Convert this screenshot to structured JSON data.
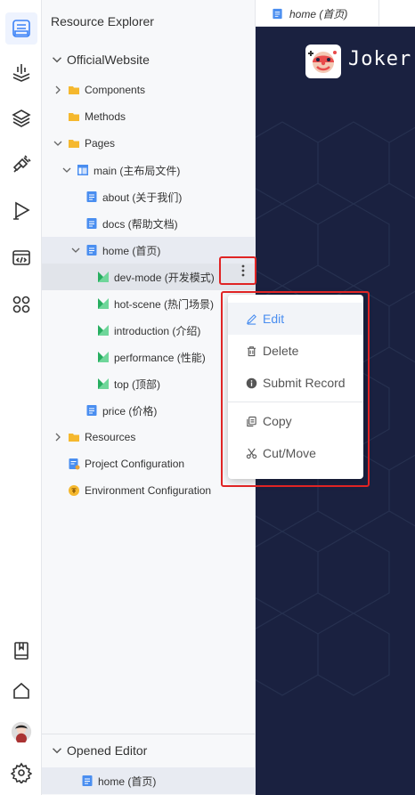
{
  "sidebar": {
    "title": "Resource Explorer",
    "project": "OfficialWebsite",
    "tree": [
      {
        "label": "Components",
        "kind": "folder"
      },
      {
        "label": "Methods",
        "kind": "folder"
      },
      {
        "label": "Pages",
        "kind": "folder"
      },
      {
        "label": "main (主布局文件)",
        "kind": "layout"
      },
      {
        "label": "about (关于我们)",
        "kind": "page"
      },
      {
        "label": "docs (帮助文档)",
        "kind": "page"
      },
      {
        "label": "home (首页)",
        "kind": "page"
      },
      {
        "label": "dev-mode (开发模式)",
        "kind": "scene"
      },
      {
        "label": "hot-scene (热门场景)",
        "kind": "scene"
      },
      {
        "label": "introduction (介绍)",
        "kind": "scene"
      },
      {
        "label": "performance (性能)",
        "kind": "scene"
      },
      {
        "label": "top (顶部)",
        "kind": "scene"
      },
      {
        "label": "price (价格)",
        "kind": "page"
      },
      {
        "label": "Resources",
        "kind": "folder"
      },
      {
        "label": "Project Configuration",
        "kind": "config"
      },
      {
        "label": "Environment Configuration",
        "kind": "env"
      }
    ],
    "opened_editor": {
      "title": "Opened Editor",
      "items": [
        {
          "label": "home (首页)"
        }
      ]
    }
  },
  "editor": {
    "tab_label": "home (首页)",
    "brand": "Joker"
  },
  "context_menu": {
    "items": [
      {
        "label": "Edit",
        "icon": "pencil-icon"
      },
      {
        "label": "Delete",
        "icon": "trash-icon"
      },
      {
        "label": "Submit Record",
        "icon": "info-icon"
      },
      {
        "label": "Copy",
        "icon": "copy-icon"
      },
      {
        "label": "Cut/Move",
        "icon": "scissors-icon"
      }
    ]
  },
  "colors": {
    "accent": "#4a8ef0",
    "folder": "#f5b82e",
    "scene": "#27ae60",
    "editor_bg": "#1a2140",
    "highlight": "#e02424"
  }
}
